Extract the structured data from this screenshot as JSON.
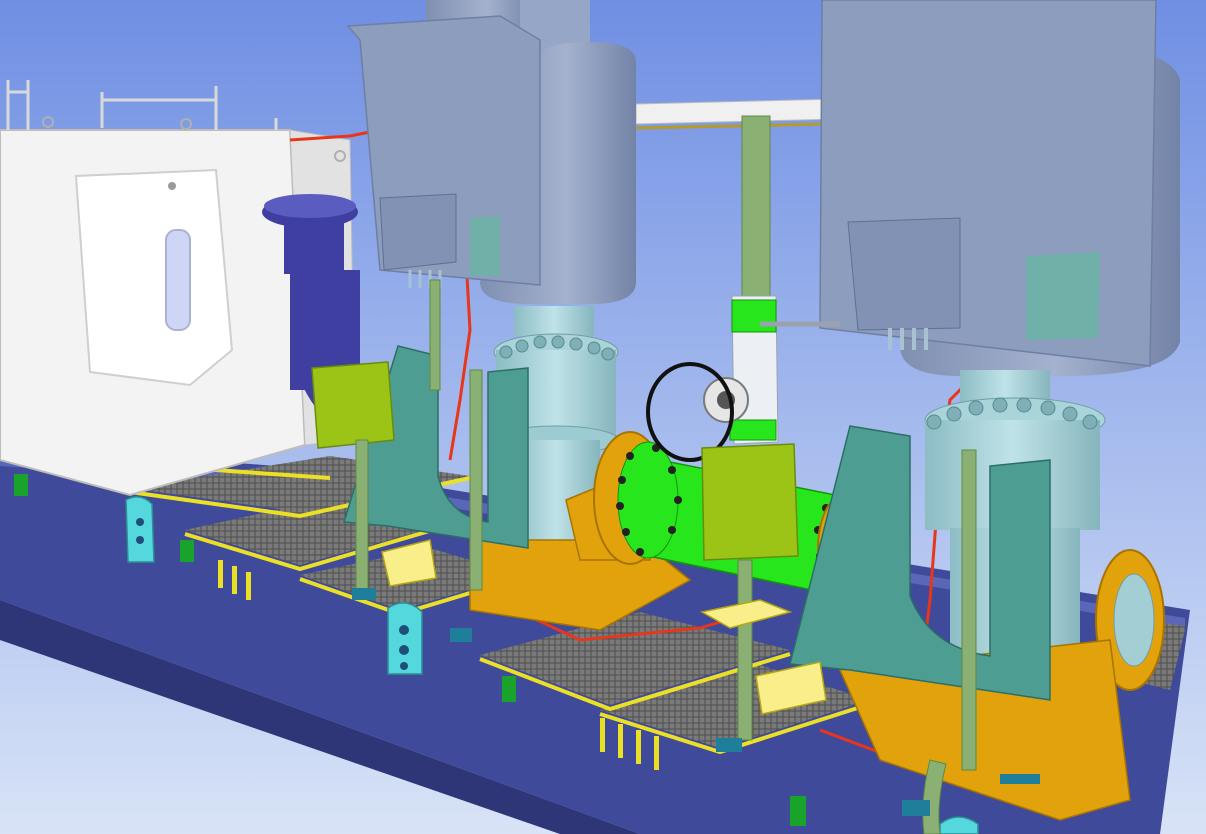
{
  "scene": {
    "kind": "3d-cad-render",
    "subject": "skid-mounted-vertical-pump-package",
    "palette": {
      "sky_top": "#6f8fe3",
      "sky_bottom": "#d8e3f7",
      "skid_frame": "#3f4a9a",
      "grating": "#6a6a6a",
      "yellow_trim": "#ece026",
      "pump_casing": "#a9d4da",
      "motor_grey": "#8f9fbe",
      "support_teal": "#4d9d93",
      "base_orange": "#e2a20c",
      "junction_box": "#9cc417",
      "pipe_green": "#27e61b",
      "pipe_navy": "#3e3fa0",
      "cable_red": "#e8361b",
      "enclosure_white": "#f3f3f3",
      "stand_green": "#8ab074"
    },
    "icons": [
      "valve-handwheel-icon",
      "lifting-lug-icon"
    ]
  }
}
